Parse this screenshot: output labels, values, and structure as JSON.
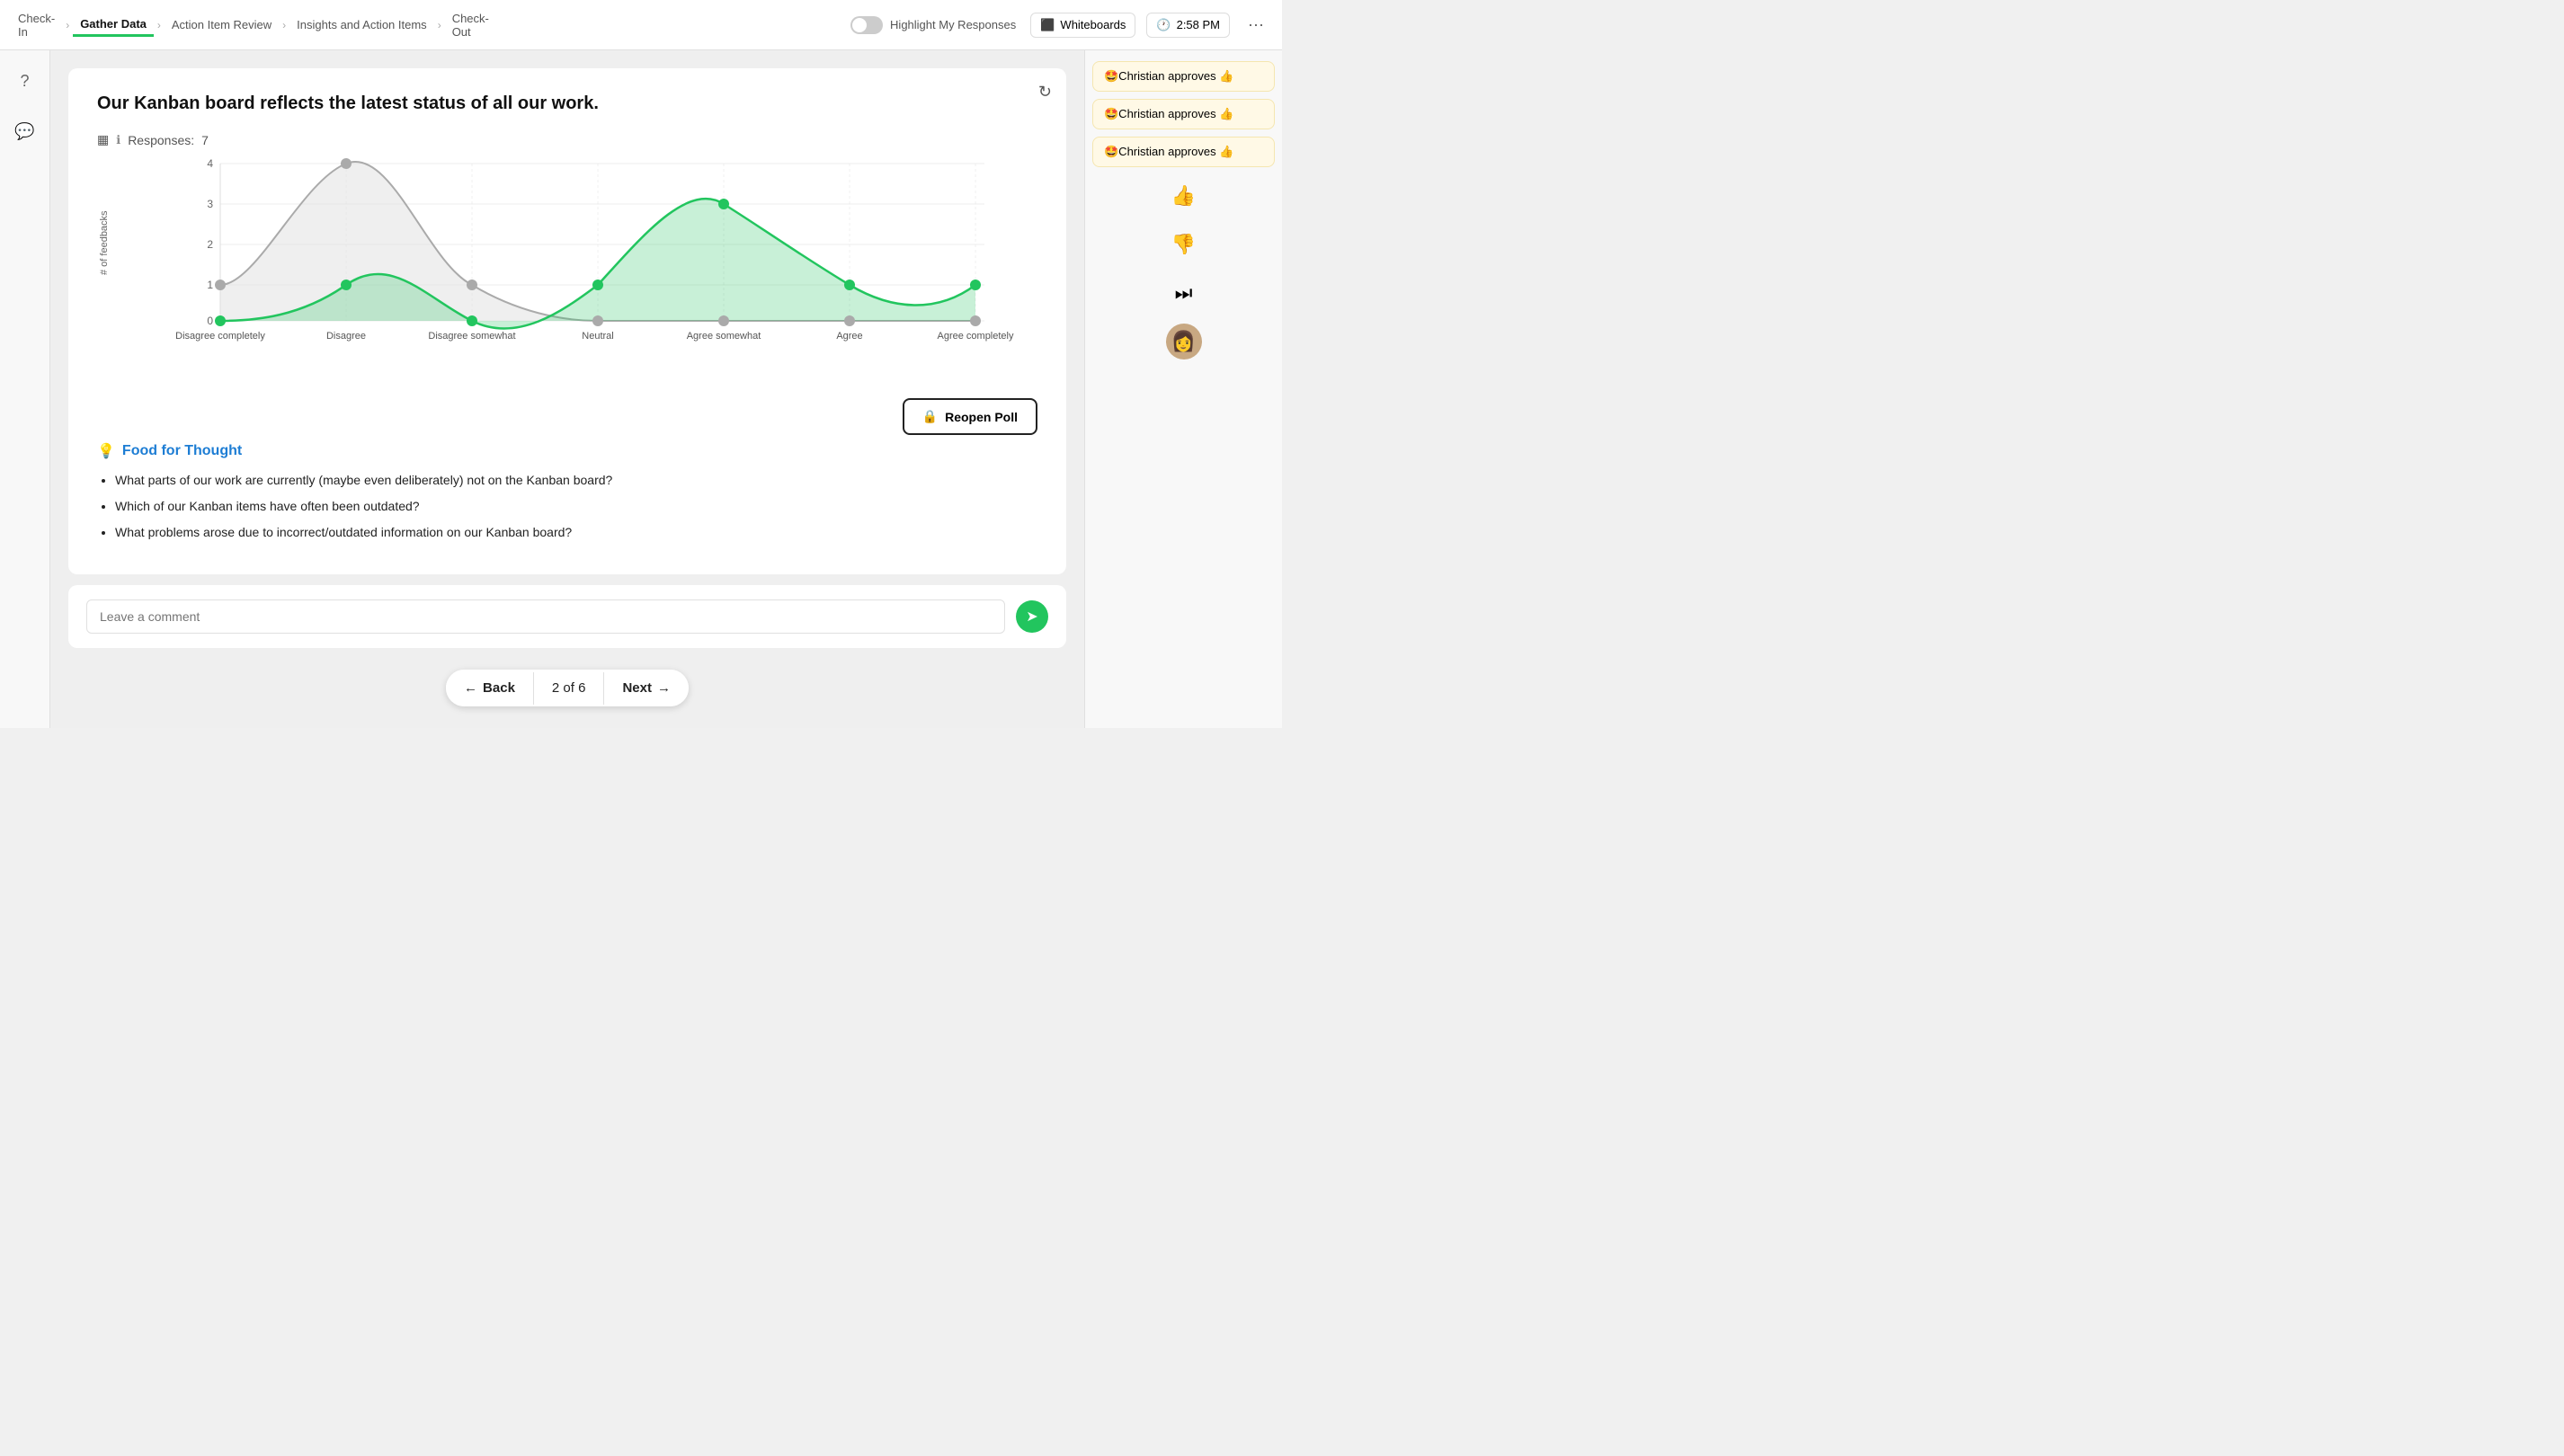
{
  "nav": {
    "steps": [
      {
        "id": "check-in",
        "label": "Check-\nIn",
        "active": false
      },
      {
        "id": "gather-data",
        "label": "Gather Data",
        "active": true
      },
      {
        "id": "action-item-review",
        "label": "Action Item Review",
        "active": false
      },
      {
        "id": "insights-action-items",
        "label": "Insights and Action Items",
        "active": false
      },
      {
        "id": "check-out",
        "label": "Check-\nOut",
        "active": false
      }
    ],
    "highlight_label": "Highlight My Responses",
    "whiteboards_label": "Whiteboards",
    "time": "2:58 PM",
    "more": "..."
  },
  "sidebar_left": {
    "icons": [
      {
        "id": "help-icon",
        "symbol": "?"
      },
      {
        "id": "chat-icon",
        "symbol": "💬"
      }
    ]
  },
  "card": {
    "title": "Our Kanban board reflects the latest status of all our work.",
    "responses_label": "Responses:",
    "responses_count": "7",
    "chart": {
      "y_label": "# of feedbacks",
      "x_labels": [
        "Disagree completely",
        "Disagree",
        "Disagree somewhat",
        "Neutral",
        "Agree somewhat",
        "Agree",
        "Agree completely"
      ],
      "y_max": 4,
      "y_ticks": [
        0,
        1,
        2,
        3,
        4
      ],
      "green_data": [
        0,
        1,
        0,
        1,
        3,
        1,
        1
      ],
      "gray_data": [
        1,
        4,
        1,
        0,
        0,
        0,
        0
      ]
    },
    "reopen_poll_label": "Reopen Poll",
    "food_section": {
      "title": "Food for Thought",
      "items": [
        "What parts of our work are currently (maybe even deliberately) not on the Kanban board?",
        "Which of our Kanban items have often been outdated?",
        "What problems arose due to incorrect/outdated information on our Kanban board?"
      ]
    }
  },
  "comment": {
    "placeholder": "Leave a comment"
  },
  "pagination": {
    "back_label": "Back",
    "next_label": "Next",
    "page_info": "2 of 6"
  },
  "right_sidebar": {
    "reactions": [
      {
        "text": "🤩Christian approves 👍"
      },
      {
        "text": "🤩Christian approves 👍"
      },
      {
        "text": "🤩Christian approves 👍"
      }
    ],
    "icons": [
      {
        "id": "thumbs-up-icon",
        "symbol": "👍"
      },
      {
        "id": "thumbs-down-icon",
        "symbol": "👎"
      },
      {
        "id": "fast-forward-icon",
        "symbol": "⏭"
      },
      {
        "id": "avatar-icon",
        "symbol": "👩"
      }
    ]
  }
}
